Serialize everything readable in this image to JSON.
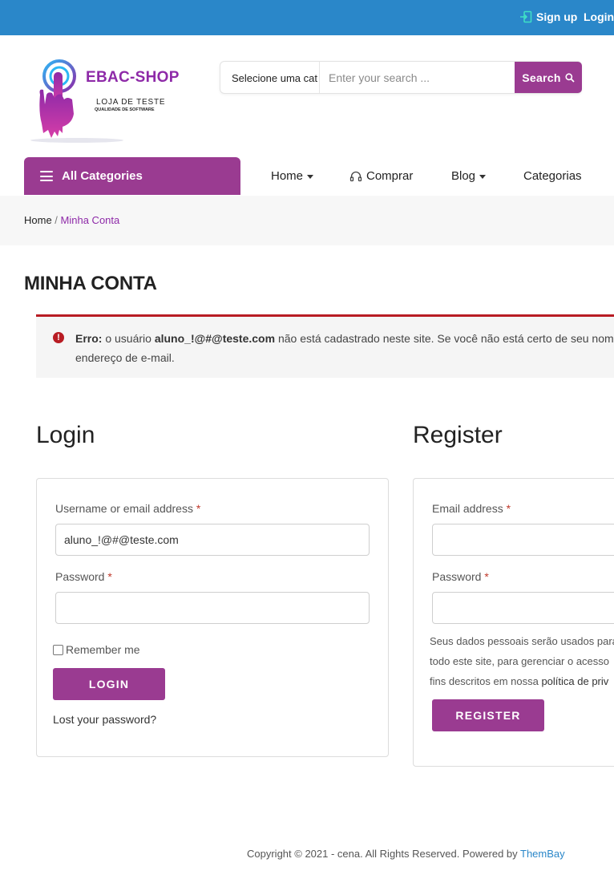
{
  "topbar": {
    "signup": "Sign up",
    "login": "Login"
  },
  "logo": {
    "brand": "EBAC-SHOP",
    "tagline": "LOJA DE TESTE",
    "subtagline": "QUALIDADE DE SOFTWARE"
  },
  "search": {
    "category": "Selecione uma cat",
    "placeholder": "Enter your search ...",
    "button": "Search"
  },
  "nav": {
    "all_categories": "All Categories",
    "home": "Home",
    "comprar": "Comprar",
    "blog": "Blog",
    "categorias": "Categorias"
  },
  "breadcrumb": {
    "home": "Home",
    "separator": " / ",
    "current": "Minha Conta"
  },
  "page_title": "MINHA CONTA",
  "notice": {
    "label": "Erro:",
    "text_a": " o usuário ",
    "user": "aluno_!@#@teste.com",
    "text_b": " não está cadastrado neste site. Se você não está certo de seu nome de usuário, experimente o",
    "line2": "endereço de e-mail."
  },
  "login": {
    "title": "Login",
    "username_label": "Username or email address",
    "username_value": "aluno_!@#@teste.com",
    "password_label": "Password",
    "required_mark": "*",
    "remember": "Remember me",
    "button": "LOGIN",
    "lost": "Lost your password?"
  },
  "register": {
    "title": "Register",
    "email_label": "Email address",
    "password_label": "Password",
    "required_mark": "*",
    "privacy_line1": "Seus dados pessoais serão usados para",
    "privacy_line2": "todo este site, para gerenciar o acesso",
    "privacy_line3_a": "fins descritos em nossa ",
    "privacy_link": "política de priv",
    "button": "REGISTER"
  },
  "footer": {
    "text": "Copyright © 2021 - cena. All Rights Reserved. Powered by ",
    "brand": "ThemBay"
  },
  "colors": {
    "topbar": "#2a87c9",
    "accent": "#9a3b91",
    "brand": "#8e2aa8",
    "error": "#b81c23",
    "link": "#2a87c9"
  }
}
